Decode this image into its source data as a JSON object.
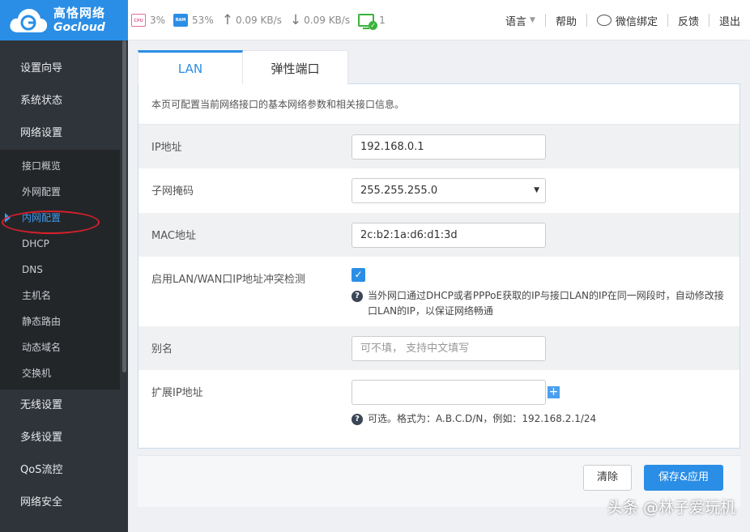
{
  "brand": {
    "name_cn": "高恪网络",
    "name_en": "Gocloud",
    "color": "#2b8ee6"
  },
  "stats": {
    "cpu_chip": "CPU",
    "cpu": "3%",
    "ram_chip": "RAM",
    "ram": "53%",
    "upload": "0.09 KB/s",
    "download": "0.09 KB/s",
    "devices": "1"
  },
  "topnav": {
    "language": "语言",
    "help": "帮助",
    "wechat": "微信绑定",
    "feedback": "反馈",
    "logout": "退出"
  },
  "sidebar": {
    "top_items": [
      "设置向导",
      "系统状态",
      "网络设置"
    ],
    "sub_items": [
      "接口概览",
      "外网配置",
      "内网配置",
      "DHCP",
      "DNS",
      "主机名",
      "静态路由",
      "动态域名",
      "交换机"
    ],
    "active_sub": "内网配置",
    "bottom_items": [
      "无线设置",
      "多线设置",
      "QoS流控",
      "网络安全"
    ]
  },
  "tabs": [
    "LAN",
    "弹性端口"
  ],
  "panel": {
    "description": "本页可配置当前网络接口的基本网络参数和相关接口信息。",
    "ip_label": "IP地址",
    "ip_value": "192.168.0.1",
    "mask_label": "子网掩码",
    "mask_value": "255.255.255.0",
    "mac_label": "MAC地址",
    "mac_value": "2c:b2:1a:d6:d1:3d",
    "conflict_label": "启用LAN/WAN口IP地址冲突检测",
    "conflict_checked": true,
    "conflict_hint": "当外网口通过DHCP或者PPPoE获取的IP与接口LAN的IP在同一网段时，自动修改接口LAN的IP，以保证网络畅通",
    "alias_label": "别名",
    "alias_placeholder": "可不填， 支持中文填写",
    "ext_label": "扩展IP地址",
    "ext_hint": "可选。格式为：A.B.C.D/N，例如：192.168.2.1/24"
  },
  "buttons": {
    "clear": "清除",
    "save": "保存&应用"
  },
  "watermark": "头条 @林子爱玩机"
}
